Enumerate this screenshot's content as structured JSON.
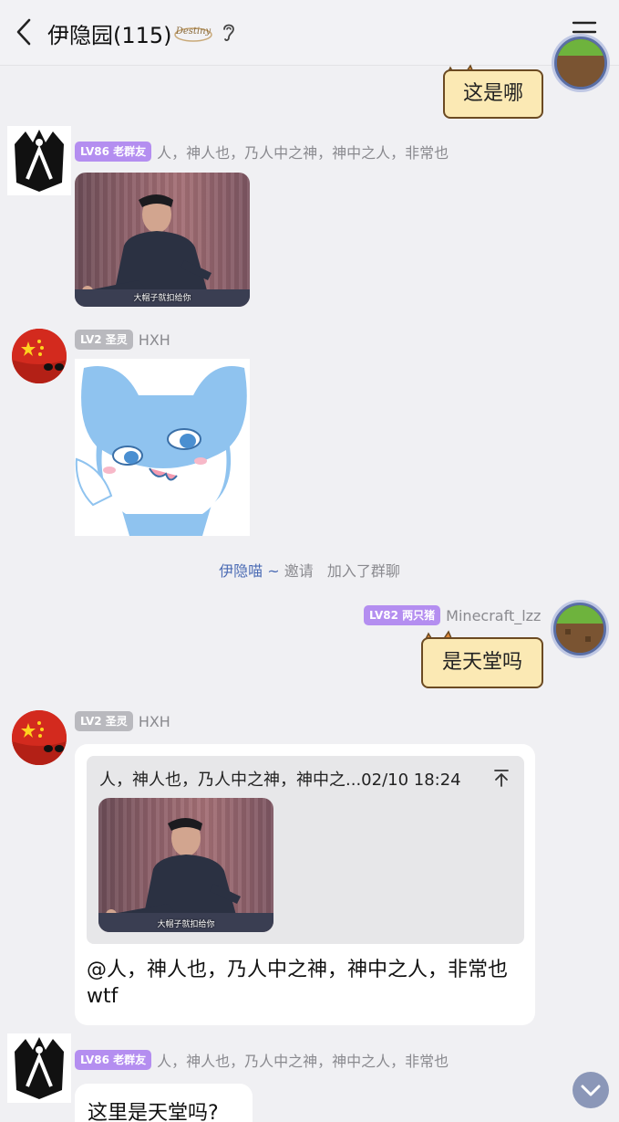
{
  "header": {
    "title": "伊隐园(115)",
    "deco_text": "Destiny"
  },
  "messages": {
    "m1": {
      "text": "这是哪"
    },
    "m2": {
      "level": "LV86 老群友",
      "name": "人，神人也，乃人中之神，神中之人，非常也",
      "image_caption": "大帽子就扣给你"
    },
    "m3": {
      "level": "LV2 圣灵",
      "name": "HXH"
    },
    "system": {
      "inviter": "伊隐喵 ~",
      "action": "邀请",
      "result": "加入了群聊"
    },
    "m4": {
      "level": "LV82 两只猪",
      "name": "Minecraft_lzz",
      "text": "是天堂吗"
    },
    "m5": {
      "level": "LV2 圣灵",
      "name": "HXH",
      "quote_text": "人，神人也，乃人中之神，神中之...02/10 18:24",
      "image_caption": "大帽子就扣给你",
      "text": "@人，神人也，乃人中之神，神中之人，非常也 wtf"
    },
    "m6": {
      "level": "LV86 老群友",
      "name": "人，神人也，乃人中之神，神中之人，非常也",
      "text": "这里是天堂吗?"
    }
  },
  "colors": {
    "background": "#f0f0f3",
    "badge_purple": "#b48ef0",
    "badge_gray": "#b9b9be",
    "cat_bubble": "#fbe9b4",
    "system_highlight": "#4b6bb4"
  },
  "icons": [
    "back-arrow-icon",
    "ear-icon",
    "menu-icon",
    "pin-top-icon",
    "chevron-down-icon"
  ]
}
